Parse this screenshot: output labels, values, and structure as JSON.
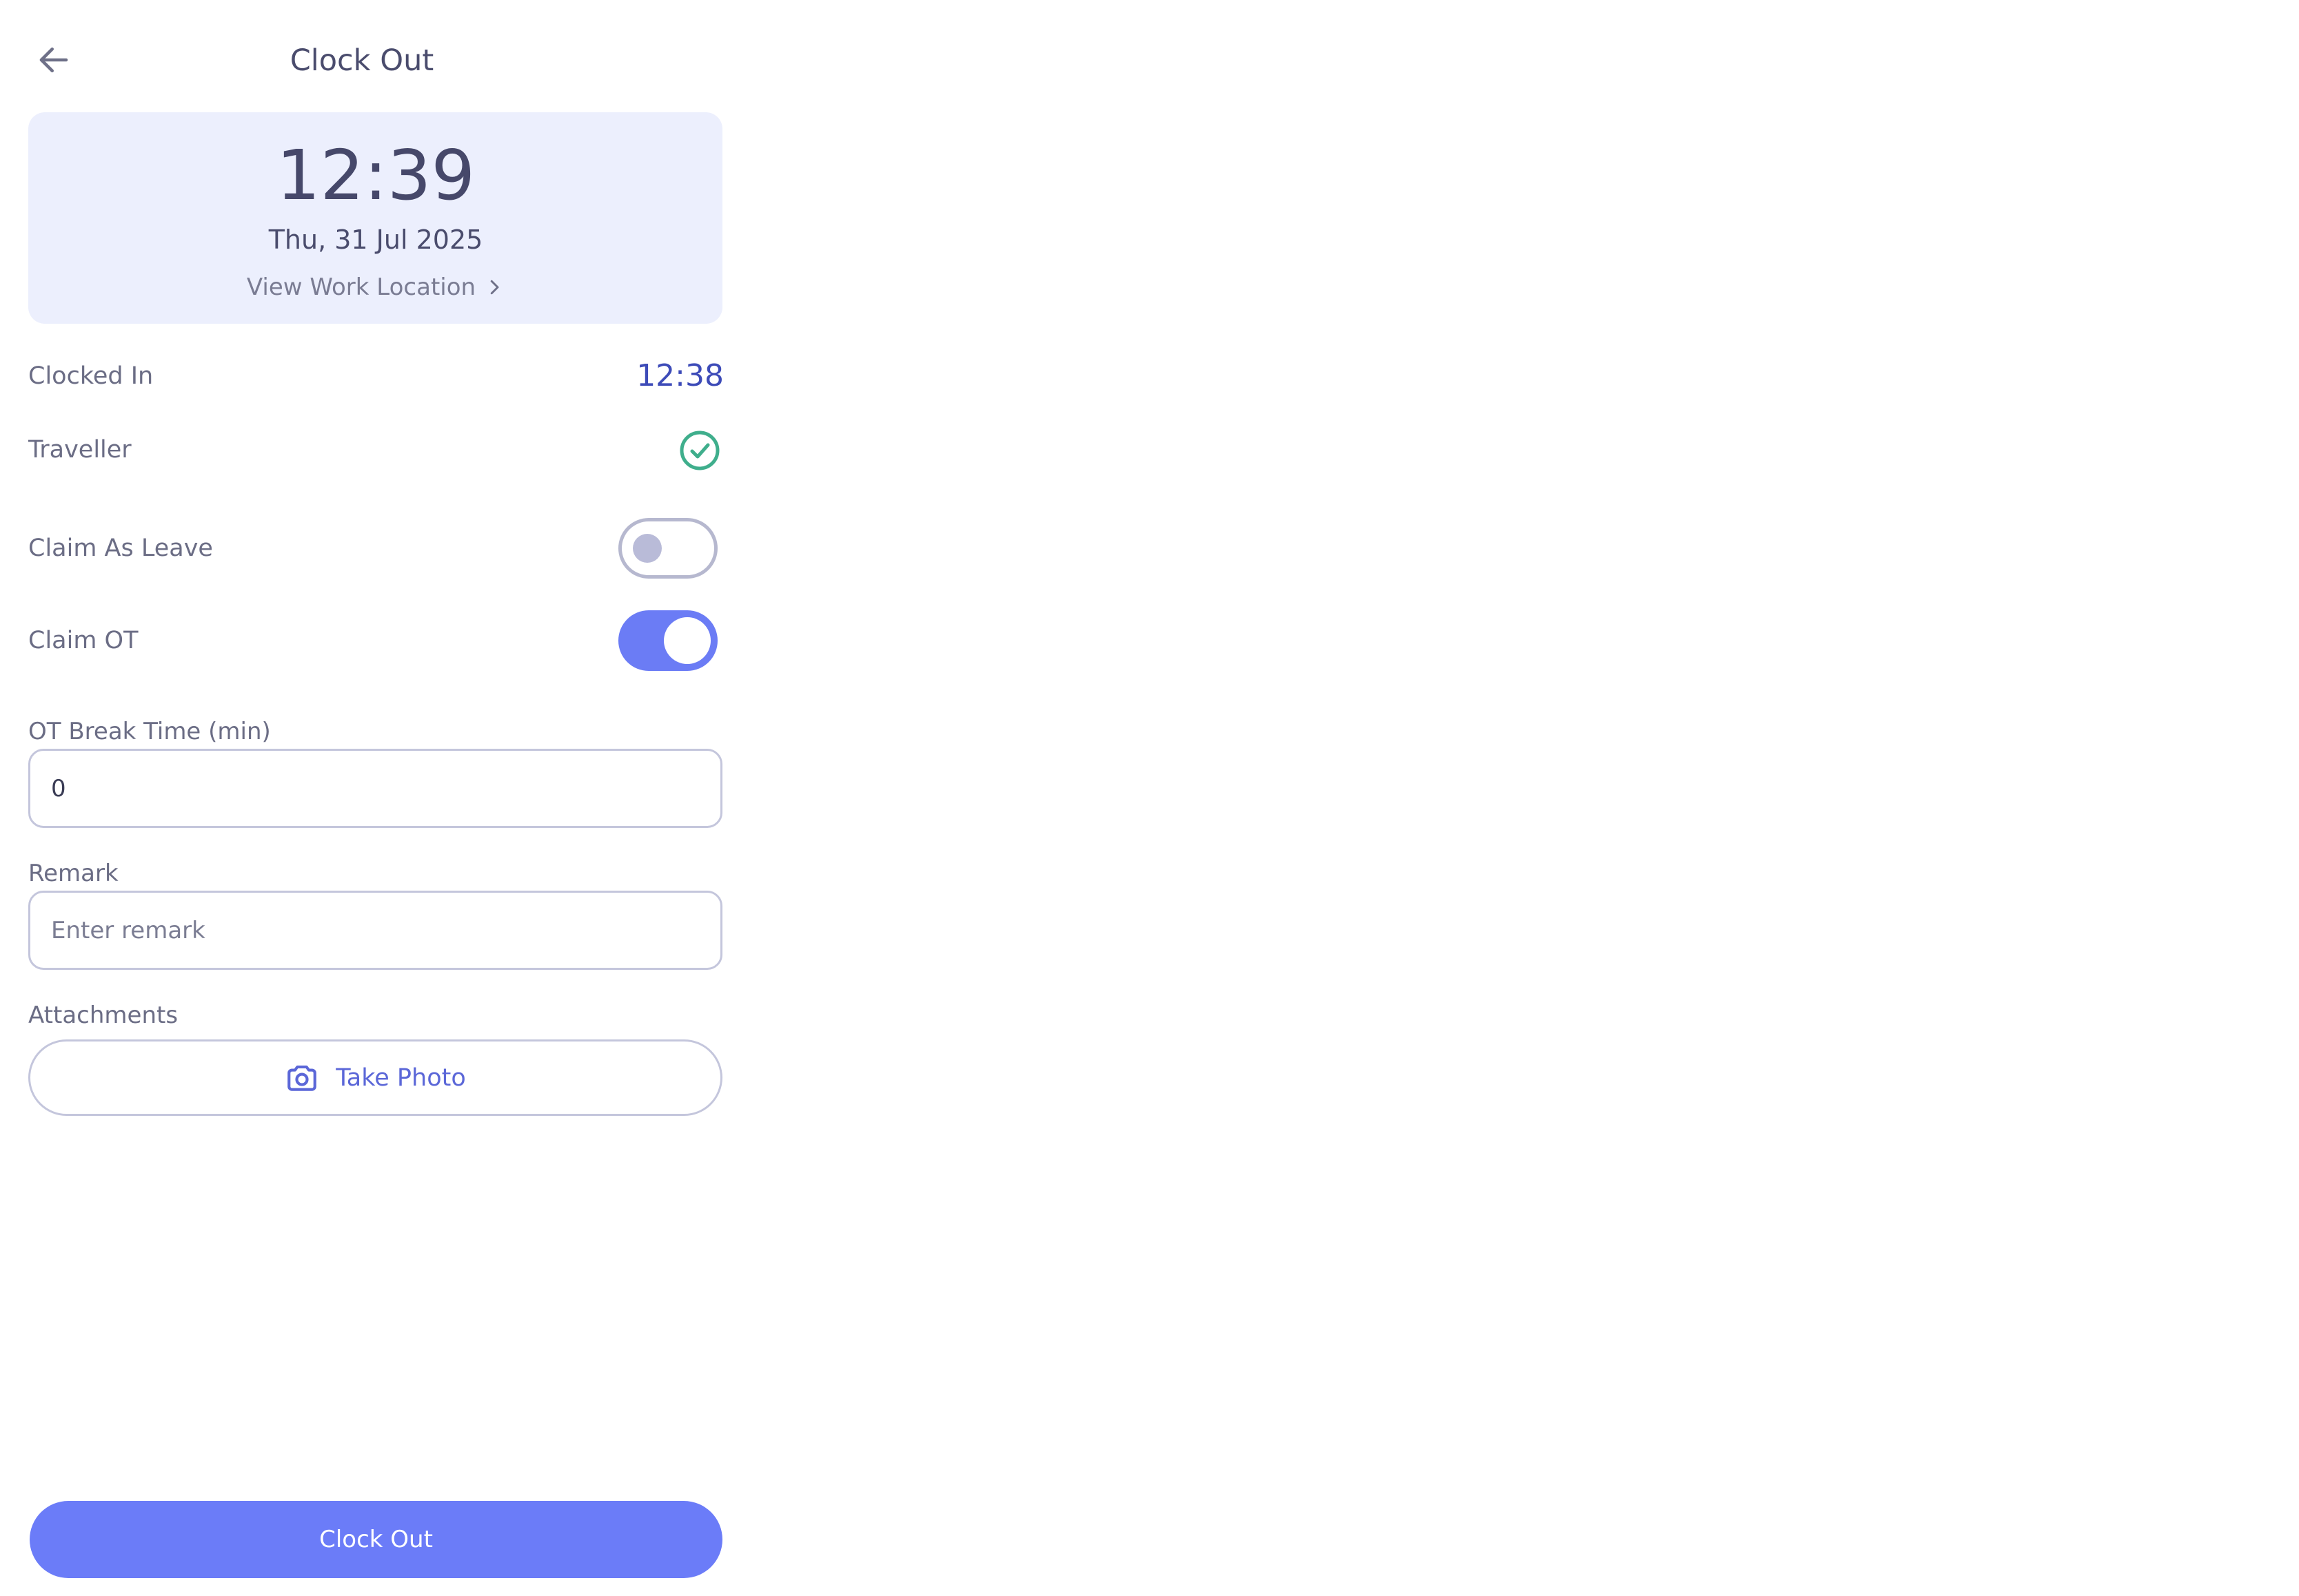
{
  "header": {
    "title": "Clock Out",
    "back_icon": "arrow-left-icon"
  },
  "time_card": {
    "time": "12:39",
    "date": "Thu, 31 Jul 2025",
    "location_link": "View Work Location"
  },
  "status": {
    "clocked_in_label": "Clocked In",
    "clocked_in_value": "12:38",
    "traveller_label": "Traveller",
    "traveller_checked": true
  },
  "toggles": {
    "claim_leave_label": "Claim As Leave",
    "claim_leave_on": false,
    "claim_ot_label": "Claim OT",
    "claim_ot_on": true
  },
  "form": {
    "ot_break_label": "OT Break Time (min)",
    "ot_break_value": "0",
    "remark_label": "Remark",
    "remark_placeholder": "Enter remark",
    "attachments_label": "Attachments",
    "take_photo_label": "Take Photo"
  },
  "footer": {
    "clock_out_label": "Clock Out"
  },
  "colors": {
    "accent": "#6b7cf8",
    "card_background": "#eceffd",
    "success": "#3fae8c",
    "clocked_in_time": "#3d4bb8"
  }
}
